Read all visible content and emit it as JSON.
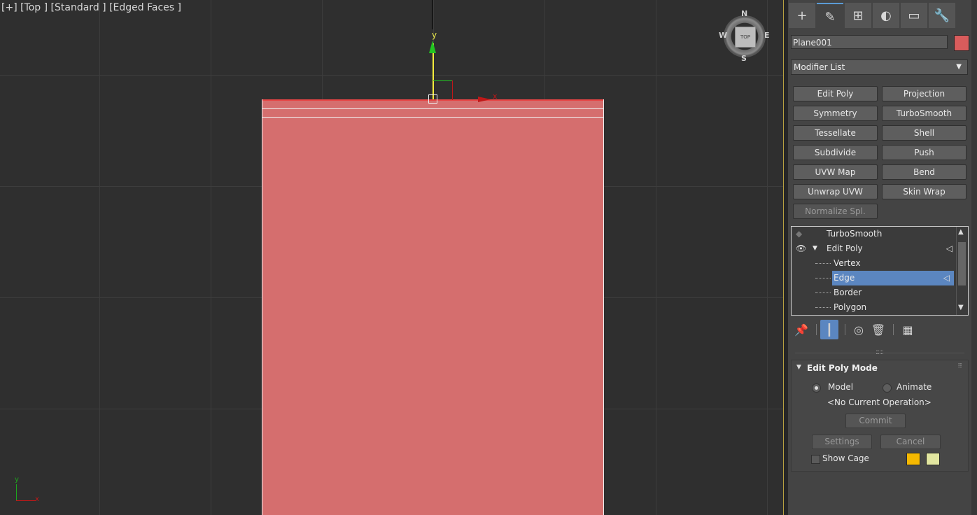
{
  "viewport": {
    "label": "[+] [Top ] [Standard ] [Edged Faces ]",
    "gizmo": {
      "y_label": "y",
      "x_label": "x"
    },
    "viewcube": {
      "face": "TOP",
      "north": "N",
      "south": "S",
      "east": "E",
      "west": "W"
    },
    "tripod": {
      "y": "y",
      "x": "x"
    }
  },
  "command_panel": {
    "tabs": [
      {
        "name": "create-tab",
        "icon": "+"
      },
      {
        "name": "modify-tab",
        "icon": "✎"
      },
      {
        "name": "hierarchy-tab",
        "icon": "⊞"
      },
      {
        "name": "motion-tab",
        "icon": "◐"
      },
      {
        "name": "display-tab",
        "icon": "▭"
      },
      {
        "name": "utilities-tab",
        "icon": "🔧"
      }
    ],
    "object_name": "Plane001",
    "object_color": "#d95c5c",
    "modifier_list": {
      "label": "Modifier List",
      "arrow": "▼"
    },
    "modifier_buttons": [
      "Edit Poly",
      "Projection",
      "Symmetry",
      "TurboSmooth",
      "Tessellate",
      "Shell",
      "Subdivide",
      "Push",
      "UVW Map",
      "Bend",
      "Unwrap UVW",
      "Skin Wrap",
      "Normalize Spl."
    ],
    "stack": {
      "items": [
        {
          "label": "TurboSmooth"
        },
        {
          "label": "Edit Poly"
        },
        {
          "label": "Vertex"
        },
        {
          "label": "Edge"
        },
        {
          "label": "Border"
        },
        {
          "label": "Polygon"
        }
      ],
      "selected": "Edge"
    },
    "rollout": {
      "title": "Edit Poly Mode",
      "model_label": "Model",
      "animate_label": "Animate",
      "operation": "<No Current Operation>",
      "commit": "Commit",
      "settings": "Settings",
      "cancel": "Cancel",
      "show_cage": "Show Cage",
      "cage_color_1": "#f5b800",
      "cage_color_2": "#e2e6a0"
    }
  }
}
